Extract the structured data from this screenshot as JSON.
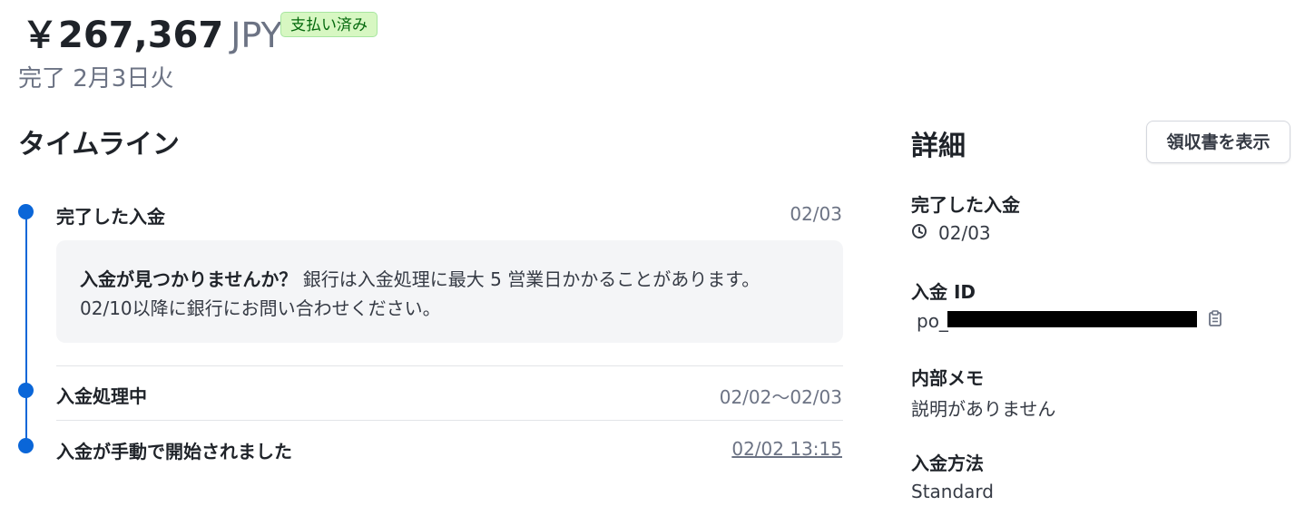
{
  "header": {
    "amount": "￥267,367",
    "currency": "JPY",
    "status_badge": "支払い済み",
    "completed_date": "完了 2月3日火"
  },
  "timeline": {
    "title": "タイムライン",
    "events": [
      {
        "title": "完了した入金",
        "date": "02/03"
      },
      {
        "title": "入金処理中",
        "date": "02/02〜02/03"
      },
      {
        "title": "入金が手動で開始されました",
        "date": "02/02 13:15"
      }
    ],
    "notice": {
      "strong": "入金が見つかりませんか？",
      "line1": " 銀行は入金処理に最大 5 営業日かかることがあります。",
      "line2": "02/10以降に銀行にお問い合わせください。"
    }
  },
  "details": {
    "title": "詳細",
    "receipt_button": "領収書を表示",
    "completed_label": "完了した入金",
    "completed_value": "02/03",
    "payout_id_label": "入金 ID",
    "payout_id_prefix": "po_",
    "memo_label": "内部メモ",
    "memo_value": "説明がありません",
    "method_label": "入金方法",
    "method_value": "Standard"
  },
  "colors": {
    "timeline_accent": "#0a66d8",
    "badge_bg": "#d7f7c2",
    "badge_text": "#05690d"
  },
  "icons": [
    "clock-icon",
    "copy-icon"
  ]
}
